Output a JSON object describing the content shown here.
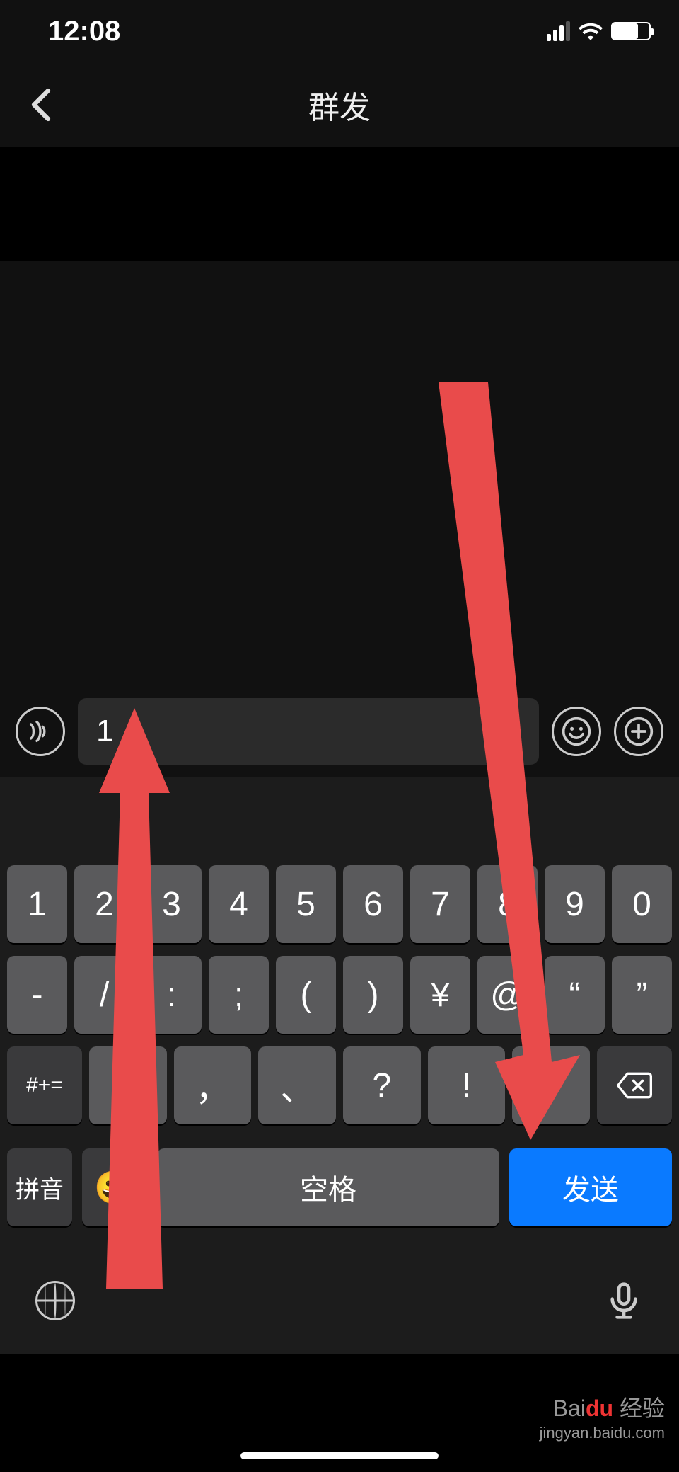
{
  "status": {
    "time": "12:08"
  },
  "nav": {
    "title": "群发"
  },
  "input": {
    "value": "1"
  },
  "keyboard": {
    "row1": [
      "1",
      "2",
      "3",
      "4",
      "5",
      "6",
      "7",
      "8",
      "9",
      "0"
    ],
    "row2": [
      "-",
      "/",
      ":",
      ";",
      "(",
      ")",
      "¥",
      "@",
      "“",
      "”"
    ],
    "row3_shift": "#+=",
    "row3": [
      "。",
      "，",
      "、",
      "?",
      "!",
      "."
    ],
    "bottom": {
      "pinyin": "拼音",
      "emoji": "😀",
      "space": "空格",
      "send": "发送"
    }
  },
  "watermark": {
    "brand_prefix": "Bai",
    "brand_suffix": "du",
    "brand_text": "经验",
    "url": "jingyan.baidu.com"
  },
  "annotations": {
    "arrows": [
      {
        "from": "keyboard-bottom-left",
        "to": "text-input",
        "color": "#e94b4b"
      },
      {
        "from": "chat-top-right",
        "to": "send-key",
        "color": "#e94b4b"
      }
    ]
  }
}
